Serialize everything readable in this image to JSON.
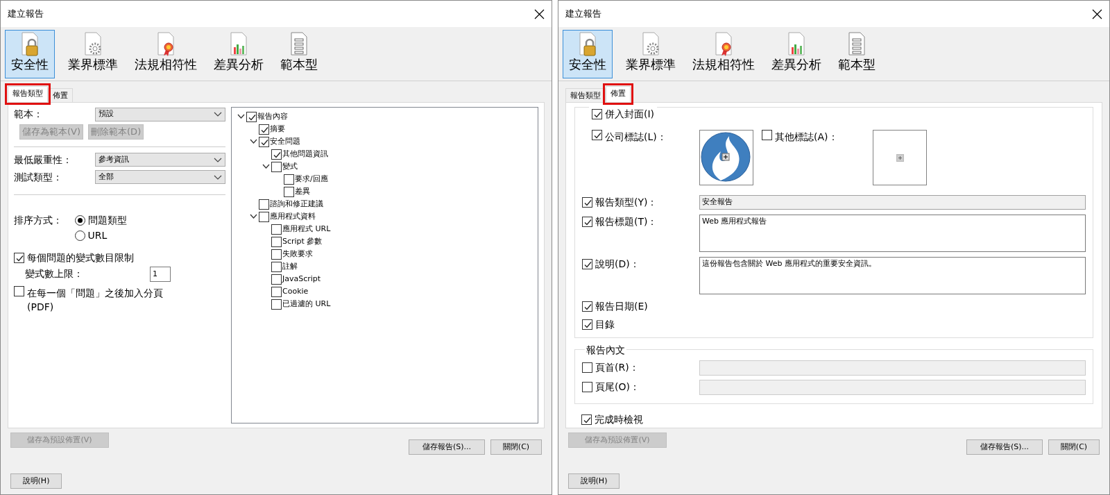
{
  "dialogs": [
    {
      "title": "建立報告",
      "categories": [
        {
          "label": "安全性",
          "selected": true
        },
        {
          "label": "業界標準",
          "selected": false
        },
        {
          "label": "法規相符性",
          "selected": false
        },
        {
          "label": "差異分析",
          "selected": false
        },
        {
          "label": "範本型",
          "selected": false
        }
      ],
      "tabs": [
        {
          "label": "報告類型",
          "selected": true,
          "highlighted": true
        },
        {
          "label": "佈置",
          "selected": false,
          "highlighted": false
        }
      ],
      "content": {
        "kind": "report_type",
        "template": {
          "label": "範本：",
          "value": "預設",
          "buttons": [
            {
              "label": "儲存為範本(V)",
              "disabled": true
            },
            {
              "label": "刪除範本(D)",
              "disabled": true
            }
          ]
        },
        "filters": [
          {
            "label": "最低嚴重性：",
            "value": "參考資訊"
          },
          {
            "label": "測試類型：",
            "value": "全部"
          }
        ],
        "sort": {
          "label": "排序方式：",
          "options": [
            {
              "label": "問題類型",
              "selected": true
            },
            {
              "label": "URL",
              "selected": false
            }
          ]
        },
        "variant_limit": {
          "label": "每個問題的變式數目限制",
          "checked": true,
          "field_label": "變式數上限：",
          "value": "1"
        },
        "page_break": {
          "label": "在每一個「問題」之後加入分頁\n(PDF)",
          "checked": false
        },
        "tree": [
          {
            "label": "報告內容",
            "checked": true,
            "expanded": true,
            "children": [
              {
                "label": "摘要",
                "checked": true
              },
              {
                "label": "安全問題",
                "checked": true,
                "expanded": true,
                "children": [
                  {
                    "label": "其他問題資訊",
                    "checked": true
                  },
                  {
                    "label": "變式",
                    "checked": false,
                    "expanded": true,
                    "children": [
                      {
                        "label": "要求/回應",
                        "checked": false
                      },
                      {
                        "label": "差異",
                        "checked": false
                      }
                    ]
                  }
                ]
              },
              {
                "label": "諮詢和修正建議",
                "checked": false
              },
              {
                "label": "應用程式資料",
                "checked": false,
                "expanded": true,
                "children": [
                  {
                    "label": "應用程式 URL",
                    "checked": false
                  },
                  {
                    "label": "Script 參數",
                    "checked": false
                  },
                  {
                    "label": "失敗要求",
                    "checked": false
                  },
                  {
                    "label": "註解",
                    "checked": false
                  },
                  {
                    "label": "JavaScript",
                    "checked": false
                  },
                  {
                    "label": "Cookie",
                    "checked": false
                  },
                  {
                    "label": "已過濾的 URL",
                    "checked": false
                  }
                ]
              }
            ]
          }
        ]
      },
      "buttons": [
        {
          "label": "儲存為預設佈置(V)",
          "kind": "save_default",
          "disabled": true
        },
        {
          "label": "儲存報告(S)...",
          "kind": "save",
          "disabled": false
        },
        {
          "label": "關閉(C)",
          "kind": "close",
          "disabled": false
        },
        {
          "label": "說明(H)",
          "kind": "help",
          "disabled": false
        }
      ]
    },
    {
      "title": "建立報告",
      "categories": [
        {
          "label": "安全性",
          "selected": true
        },
        {
          "label": "業界標準",
          "selected": false
        },
        {
          "label": "法規相符性",
          "selected": false
        },
        {
          "label": "差異分析",
          "selected": false
        },
        {
          "label": "範本型",
          "selected": false
        }
      ],
      "tabs": [
        {
          "label": "報告類型",
          "selected": false,
          "highlighted": false
        },
        {
          "label": "佈置",
          "selected": true,
          "highlighted": true
        }
      ],
      "content": {
        "kind": "layout",
        "cover": {
          "label": "併入封面(I)",
          "checked": true
        },
        "logos": [
          {
            "label": "公司標誌(L)：",
            "checked": true,
            "kind": "logo"
          },
          {
            "label": "其他標誌(A)：",
            "checked": false,
            "kind": "empty"
          }
        ],
        "fields": [
          {
            "label": "報告類型(Y)：",
            "checked": true,
            "value": "安全報告",
            "kind": "readonly"
          },
          {
            "label": "報告標題(T)：",
            "checked": true,
            "value": "Web 應用程式報告",
            "kind": "multiline"
          },
          {
            "label": "說明(D)：",
            "checked": true,
            "value": "這份報告包含關於 Web 應用程式的重要安全資訊。",
            "kind": "multiline"
          }
        ],
        "options": [
          {
            "label": "報告日期(E)",
            "checked": true
          },
          {
            "label": "目錄",
            "checked": true
          }
        ],
        "body": {
          "title": "報告內文",
          "fields": [
            {
              "label": "頁首(R)：",
              "checked": false,
              "disabled": true
            },
            {
              "label": "頁尾(O)：",
              "checked": false,
              "disabled": true
            }
          ]
        },
        "view_on_finish": {
          "label": "完成時檢視",
          "checked": true
        }
      },
      "buttons": [
        {
          "label": "儲存為預設佈置(V)",
          "kind": "save_default",
          "disabled": true
        },
        {
          "label": "儲存報告(S)...",
          "kind": "save",
          "disabled": false
        },
        {
          "label": "關閉(C)",
          "kind": "close",
          "disabled": false
        },
        {
          "label": "說明(H)",
          "kind": "help",
          "disabled": false
        }
      ]
    }
  ]
}
